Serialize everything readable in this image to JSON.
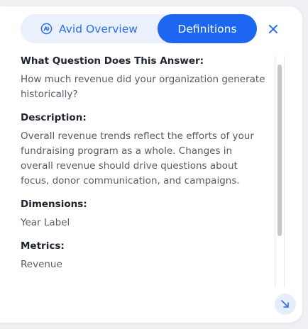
{
  "tabs": {
    "overview_label": "Avid Overview",
    "definitions_label": "Definitions",
    "active": "Definitions"
  },
  "sections": {
    "question_title": "What Question Does This Answer:",
    "question_text": "How much revenue did your organization generate historically?",
    "description_title": "Description:",
    "description_text": "Overall revenue trends reflect the efforts of your fundraising program as a whole. Changes in overall revenue should drive questions about focus, donor communication, and campaigns.",
    "dimensions_title": "Dimensions:",
    "dimensions_text": "Year Label",
    "metrics_title": "Metrics:",
    "metrics_text": "Revenue"
  },
  "icons": {
    "overview_icon": "avid-logo-icon",
    "close": "close-icon",
    "corner": "collapse-arrow-icon"
  },
  "colors": {
    "accent": "#1c66f2",
    "tab_bg": "#eaf1fd",
    "title_text": "#1f2430",
    "body_text": "#555b66"
  }
}
